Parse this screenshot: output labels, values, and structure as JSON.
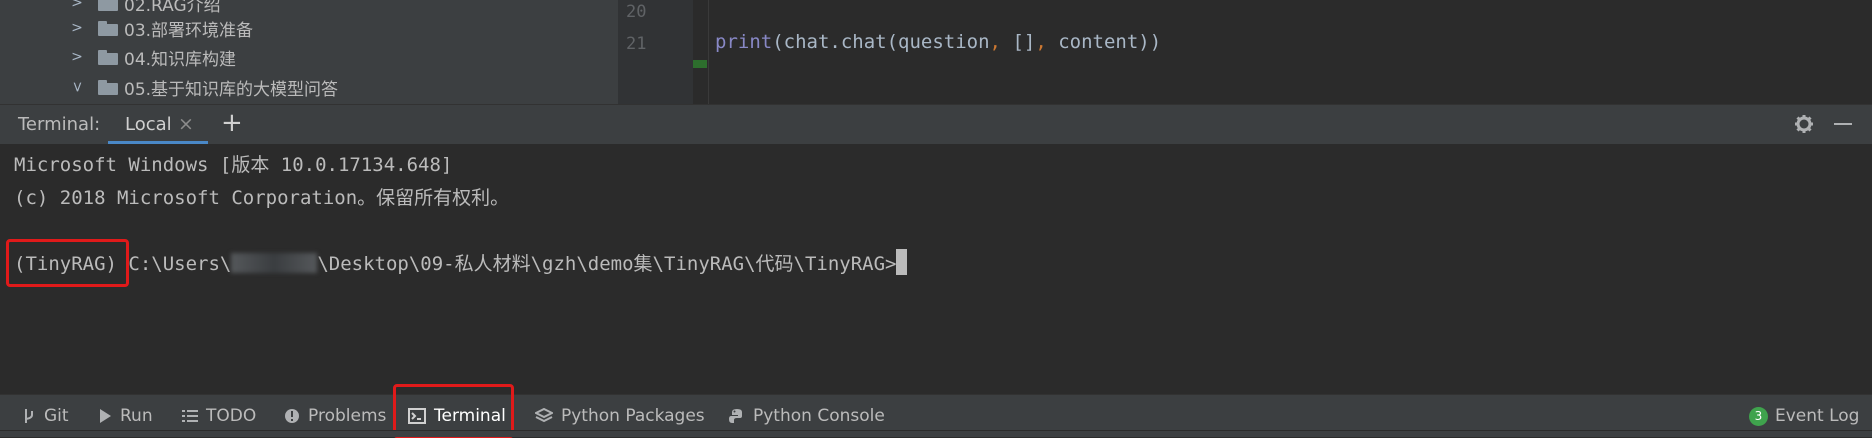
{
  "project_tree": {
    "items": [
      {
        "label": "02.RAG介绍",
        "expanded": false
      },
      {
        "label": "03.部署环境准备",
        "expanded": false
      },
      {
        "label": "04.知识库构建",
        "expanded": false
      },
      {
        "label": "05.基于知识库的大模型问答",
        "expanded": true
      }
    ]
  },
  "editor": {
    "line_numbers": [
      "20",
      "21"
    ],
    "code_line_21": {
      "func": "print",
      "part1": "(chat.chat(question",
      "comma1": ",",
      "part2": " []",
      "comma2": ",",
      "part3": " content))"
    }
  },
  "terminal": {
    "title": "Terminal:",
    "tab_local": "Local",
    "close_glyph": "×",
    "add_glyph": "+",
    "lines": [
      "Microsoft Windows [版本 10.0.17134.648]",
      "(c) 2018 Microsoft Corporation。保留所有权利。"
    ],
    "prompt": {
      "env": "(TinyRAG)",
      "path_prefix": " C:\\Users\\",
      "path_suffix": "\\Desktop\\09-私人材料\\gzh\\demo集\\TinyRAG\\代码\\TinyRAG>"
    }
  },
  "toolstrip": {
    "git": "Git",
    "run": "Run",
    "todo": "TODO",
    "problems": "Problems",
    "terminal": "Terminal",
    "python_packages": "Python Packages",
    "python_console": "Python Console",
    "event_log": "Event Log",
    "event_log_count": "3"
  },
  "colors": {
    "highlight_box": "#e01a1a",
    "tab_underline": "#4a88c7",
    "event_badge": "#3fa34d"
  }
}
